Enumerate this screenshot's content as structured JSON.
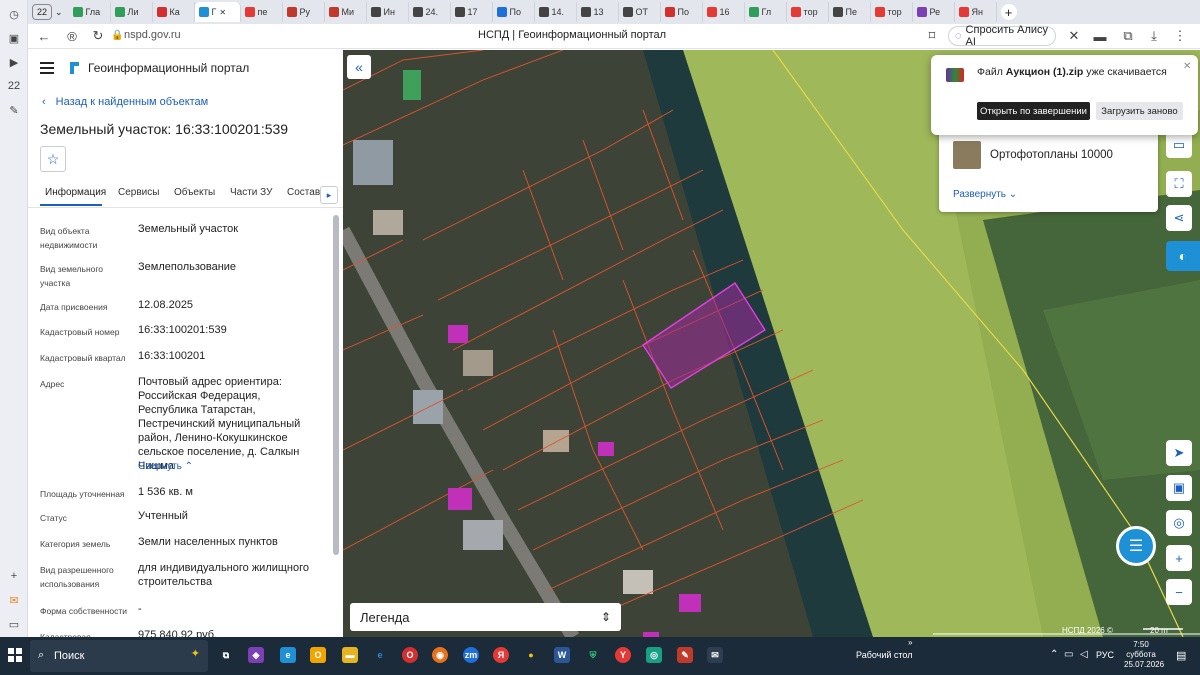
{
  "browser": {
    "tab_count": "22",
    "tabs": [
      {
        "label": "Гла",
        "color": "#2f9e5a"
      },
      {
        "label": "Ли",
        "color": "#2f9e5a"
      },
      {
        "label": "Ка",
        "color": "#d32f2f"
      },
      {
        "label": "Г",
        "color": "#1e90d6",
        "active": true
      },
      {
        "label": "пе",
        "color": "#e53935"
      },
      {
        "label": "Ру",
        "color": "#c0392b"
      },
      {
        "label": "Ми",
        "color": "#c0392b"
      },
      {
        "label": "Ин",
        "color": "#444"
      },
      {
        "label": "24.",
        "color": "#444"
      },
      {
        "label": "17",
        "color": "#444"
      },
      {
        "label": "По",
        "color": "#1e6fd9"
      },
      {
        "label": "14.",
        "color": "#444"
      },
      {
        "label": "13",
        "color": "#444"
      },
      {
        "label": "ОТ",
        "color": "#444"
      },
      {
        "label": "По",
        "color": "#d32f2f"
      },
      {
        "label": "16",
        "color": "#e53935"
      },
      {
        "label": "Гл",
        "color": "#2f9e5a"
      },
      {
        "label": "тор",
        "color": "#e53935"
      },
      {
        "label": "Пе",
        "color": "#444"
      },
      {
        "label": "тор",
        "color": "#e53935"
      },
      {
        "label": "Ре",
        "color": "#7b3fb6"
      },
      {
        "label": "Ян",
        "color": "#e53935"
      }
    ],
    "url": "nspd.gov.ru",
    "page_title": "НСПД | Геоинформационный портал",
    "alice_label": "Спросить Алису AI"
  },
  "panel": {
    "header_title": "Геоинформационный портал",
    "back_link": "Назад к найденным объектам",
    "object_title": "Земельный участок: 16:33:100201:539",
    "tabs": [
      "Информация",
      "Сервисы",
      "Объекты",
      "Части ЗУ",
      "Состав"
    ],
    "fields": [
      {
        "label": "Вид объекта недвижимости",
        "value": "Земельный участок"
      },
      {
        "label": "Вид земельного участка",
        "value": "Землепользование"
      },
      {
        "label": "Дата присвоения",
        "value": "12.08.2025"
      },
      {
        "label": "Кадастровый номер",
        "value": "16:33:100201:539"
      },
      {
        "label": "Кадастровый квартал",
        "value": "16:33:100201"
      },
      {
        "label": "Адрес",
        "value": "Почтовый адрес ориентира: Российская Федерация, Республика Татарстан, Пестречинский муниципальный район, Ленино-Кокушкинское сельское поселение, д. Салкын Чишма"
      },
      {
        "label": "Площадь уточненная",
        "value": "1 536 кв. м"
      },
      {
        "label": "Статус",
        "value": "Учтенный"
      },
      {
        "label": "Категория земель",
        "value": "Земли населенных пунктов"
      },
      {
        "label": "Вид разрешенного использования",
        "value": "для индивидуального жилищного строительства"
      },
      {
        "label": "Форма собственности",
        "value": "-"
      },
      {
        "label": "Кадастровая",
        "value": "975 840,92 руб."
      }
    ],
    "collapse_label": "Свернуть"
  },
  "map": {
    "legend_label": "Легенда",
    "scale_copyright": "НСПД 2026 ©",
    "scale_label": "20 m",
    "layer_name": "Ортофотопланы 10000",
    "expand_label": "Развернуть"
  },
  "download": {
    "text_prefix": "Файл ",
    "file_name": "Аукцион (1).zip",
    "text_suffix": " уже скачивается",
    "open_label": "Открыть по завершении",
    "retry_label": "Загрузить заново"
  },
  "taskbar": {
    "search_label": "Поиск",
    "desktop_label": "Рабочий стол",
    "lang": "РУС",
    "time": "7:50",
    "day": "суббота",
    "date": "25.07.2026"
  },
  "colors": {
    "accent": "#1b5fbf",
    "parcel_outline": "#e0542c",
    "selected_parcel": "#d02ccf",
    "field_green": "#9fb85a"
  }
}
